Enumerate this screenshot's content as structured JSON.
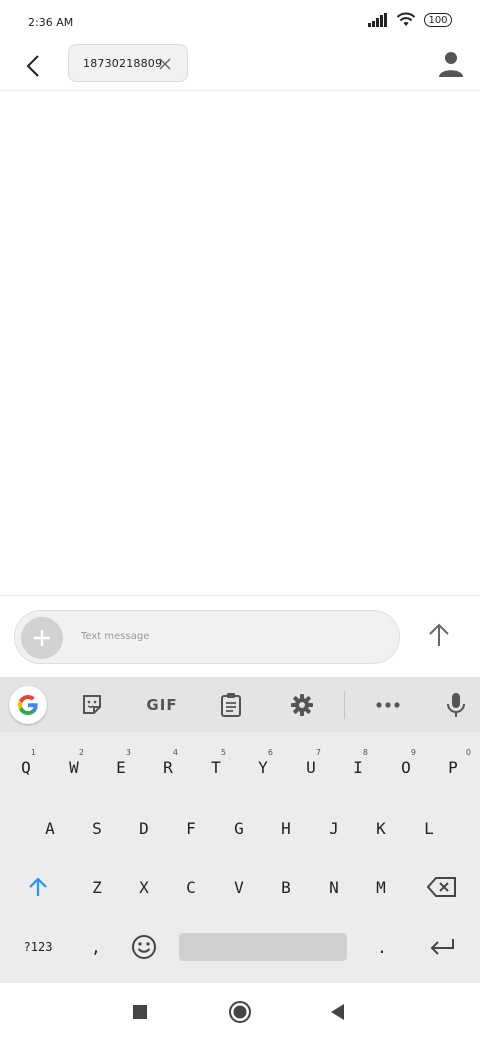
{
  "status_bar": {
    "time": "2:36 AM",
    "battery": "100",
    "icons": [
      "signal-icon",
      "wifi-icon",
      "battery-icon"
    ]
  },
  "app_bar": {
    "recipient": "18730218809",
    "icons": [
      "back-arrow-icon",
      "close-icon",
      "contact-icon"
    ]
  },
  "compose": {
    "placeholder": "Text message",
    "icons": [
      "plus-icon",
      "send-arrow-icon"
    ]
  },
  "keyboard_toolbar": {
    "gif_label": "GIF",
    "icons": [
      "google-g-icon",
      "sticker-icon",
      "clipboard-icon",
      "gear-icon",
      "more-dots-icon",
      "microphone-icon"
    ]
  },
  "keyboard": {
    "row1": [
      {
        "key": "Q",
        "hint": "1"
      },
      {
        "key": "W",
        "hint": "2"
      },
      {
        "key": "E",
        "hint": "3"
      },
      {
        "key": "R",
        "hint": "4"
      },
      {
        "key": "T",
        "hint": "5"
      },
      {
        "key": "Y",
        "hint": "6"
      },
      {
        "key": "U",
        "hint": "7"
      },
      {
        "key": "I",
        "hint": "8"
      },
      {
        "key": "O",
        "hint": "9"
      },
      {
        "key": "P",
        "hint": "0"
      }
    ],
    "row2": [
      "A",
      "S",
      "D",
      "F",
      "G",
      "H",
      "J",
      "K",
      "L"
    ],
    "row3": [
      "Z",
      "X",
      "C",
      "V",
      "B",
      "N",
      "M"
    ],
    "row4": {
      "symbols": "?123",
      "comma": ",",
      "period": "."
    },
    "accent_color": "#2196F3"
  },
  "nav_bar": {
    "icons": [
      "recents-square-icon",
      "home-circle-icon",
      "back-triangle-icon"
    ]
  }
}
